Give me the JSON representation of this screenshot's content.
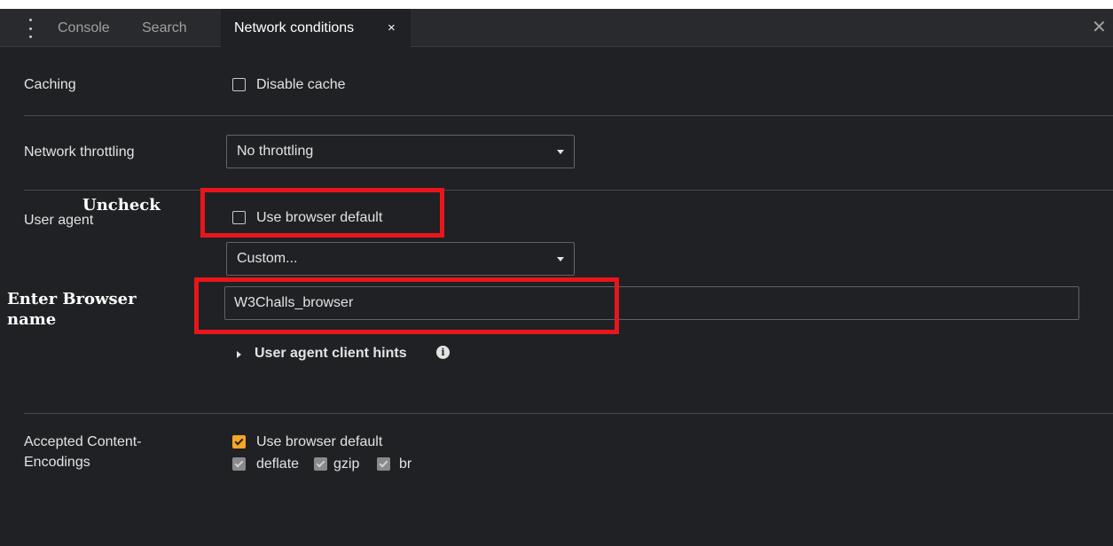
{
  "tabs": {
    "console": "Console",
    "search": "Search",
    "network_conditions": "Network conditions",
    "close_tab_glyph": "×",
    "close_panel_glyph": "✕"
  },
  "caching": {
    "label": "Caching",
    "disable_cache_label": "Disable cache",
    "disable_cache_checked": false
  },
  "throttling": {
    "label": "Network throttling",
    "selected": "No throttling"
  },
  "user_agent": {
    "label": "User agent",
    "use_default_label": "Use browser default",
    "use_default_checked": false,
    "select_value": "Custom...",
    "custom_value": "W3Challs_browser",
    "client_hints_label": "User agent client hints",
    "info_glyph": "i"
  },
  "encodings": {
    "label_line1": "Accepted Content-",
    "label_line2": "Encodings",
    "use_default_label": "Use browser default",
    "use_default_checked": true,
    "deflate": "deflate",
    "gzip": "gzip",
    "br": "br"
  },
  "annotations": {
    "uncheck": "Uncheck",
    "enter_line1": "Enter Browser",
    "enter_line2": "name",
    "highlight_color": "#e8161b"
  },
  "colors": {
    "accent_checkbox": "#f5a623",
    "background": "#202124"
  }
}
